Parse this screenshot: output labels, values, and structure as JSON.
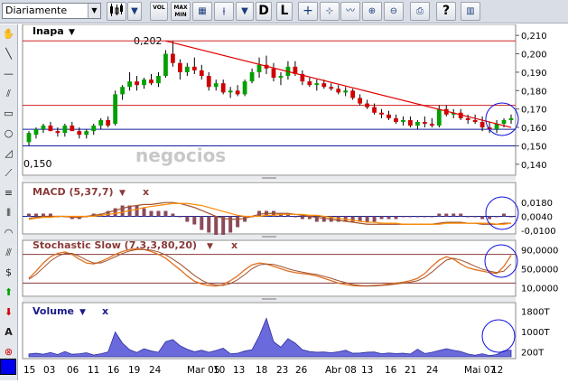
{
  "toolbar": {
    "period": "Diariamente",
    "vol_label": "VOL",
    "maxmin_label_1": "MAX",
    "maxmin_label_2": "MIN",
    "d_label": "D",
    "l_label": "L",
    "help_label": "?"
  },
  "price_panel": {
    "symbol": "Inapa",
    "high_annotation": "0,202",
    "low_annotation": "0,150",
    "watermark": "negocios",
    "y_ticks": [
      "0,210",
      "0,200",
      "0,190",
      "0,180",
      "0,170",
      "0,160",
      "0,150",
      "0,140"
    ]
  },
  "macd_panel": {
    "title": "MACD (5,37,7)",
    "close_label": "x",
    "y_ticks": [
      "0,0180",
      "0,0040",
      "-0,0100"
    ]
  },
  "stoch_panel": {
    "title": "Stochastic Slow (7,3,3,80,20)",
    "close_label": "x",
    "y_ticks": [
      "90,0000",
      "50,0000",
      "10,0000"
    ]
  },
  "volume_panel": {
    "title": "Volume",
    "close_label": "x",
    "y_ticks": [
      "1800T",
      "1000T",
      "200T"
    ]
  },
  "x_axis": [
    "15",
    "03",
    "06",
    "11",
    "16",
    "19",
    "24",
    "Mar 05",
    "10",
    "13",
    "18",
    "23",
    "26",
    "Abr 08",
    "13",
    "16",
    "21",
    "24",
    "Mai 07",
    "12"
  ],
  "colors": {
    "up_candle": "#00a000",
    "down_candle": "#d00000",
    "trendline": "#e00000",
    "support_line": "#1020a0",
    "highlight_circle": "#1010e0",
    "macd_line": "#a0522d",
    "signal_line": "#ff8c00",
    "histogram": "#8b4a5a",
    "volume_fill": "#6a6adc"
  },
  "chart_data": {
    "type": "candlestick",
    "title": "Inapa",
    "x_tick_labels": [
      "15",
      "03",
      "06",
      "11",
      "16",
      "19",
      "24",
      "Mar 05",
      "10",
      "13",
      "18",
      "23",
      "26",
      "Abr 08",
      "13",
      "16",
      "21",
      "24",
      "Mai 07",
      "12"
    ],
    "ylim": [
      0.135,
      0.215
    ],
    "candles": [
      [
        0.152,
        0.158,
        0.15,
        0.157
      ],
      [
        0.156,
        0.16,
        0.154,
        0.159
      ],
      [
        0.159,
        0.162,
        0.157,
        0.161
      ],
      [
        0.161,
        0.163,
        0.158,
        0.158
      ],
      [
        0.158,
        0.16,
        0.155,
        0.157
      ],
      [
        0.157,
        0.162,
        0.155,
        0.161
      ],
      [
        0.161,
        0.163,
        0.158,
        0.158
      ],
      [
        0.158,
        0.16,
        0.154,
        0.156
      ],
      [
        0.156,
        0.159,
        0.154,
        0.158
      ],
      [
        0.158,
        0.162,
        0.156,
        0.161
      ],
      [
        0.161,
        0.165,
        0.159,
        0.164
      ],
      [
        0.164,
        0.166,
        0.16,
        0.161
      ],
      [
        0.162,
        0.18,
        0.161,
        0.178
      ],
      [
        0.178,
        0.183,
        0.175,
        0.182
      ],
      [
        0.182,
        0.19,
        0.18,
        0.185
      ],
      [
        0.185,
        0.188,
        0.18,
        0.183
      ],
      [
        0.183,
        0.187,
        0.181,
        0.186
      ],
      [
        0.186,
        0.189,
        0.183,
        0.184
      ],
      [
        0.184,
        0.19,
        0.182,
        0.188
      ],
      [
        0.188,
        0.202,
        0.187,
        0.2
      ],
      [
        0.2,
        0.207,
        0.193,
        0.195
      ],
      [
        0.195,
        0.197,
        0.186,
        0.19
      ],
      [
        0.19,
        0.195,
        0.188,
        0.193
      ],
      [
        0.193,
        0.198,
        0.189,
        0.191
      ],
      [
        0.191,
        0.194,
        0.186,
        0.188
      ],
      [
        0.188,
        0.19,
        0.18,
        0.182
      ],
      [
        0.182,
        0.186,
        0.18,
        0.184
      ],
      [
        0.184,
        0.186,
        0.178,
        0.179
      ],
      [
        0.179,
        0.182,
        0.176,
        0.18
      ],
      [
        0.18,
        0.183,
        0.177,
        0.178
      ],
      [
        0.178,
        0.186,
        0.177,
        0.185
      ],
      [
        0.185,
        0.192,
        0.184,
        0.19
      ],
      [
        0.19,
        0.198,
        0.187,
        0.194
      ],
      [
        0.194,
        0.199,
        0.189,
        0.192
      ],
      [
        0.192,
        0.195,
        0.185,
        0.187
      ],
      [
        0.187,
        0.19,
        0.183,
        0.188
      ],
      [
        0.188,
        0.196,
        0.186,
        0.193
      ],
      [
        0.193,
        0.196,
        0.188,
        0.189
      ],
      [
        0.189,
        0.191,
        0.183,
        0.185
      ],
      [
        0.185,
        0.187,
        0.182,
        0.183
      ],
      [
        0.183,
        0.186,
        0.18,
        0.184
      ],
      [
        0.184,
        0.186,
        0.181,
        0.182
      ],
      [
        0.182,
        0.184,
        0.18,
        0.181
      ],
      [
        0.181,
        0.183,
        0.178,
        0.179
      ],
      [
        0.179,
        0.182,
        0.177,
        0.18
      ],
      [
        0.18,
        0.181,
        0.175,
        0.176
      ],
      [
        0.176,
        0.178,
        0.172,
        0.173
      ],
      [
        0.173,
        0.175,
        0.17,
        0.171
      ],
      [
        0.171,
        0.173,
        0.167,
        0.168
      ],
      [
        0.168,
        0.17,
        0.165,
        0.167
      ],
      [
        0.167,
        0.169,
        0.164,
        0.165
      ],
      [
        0.165,
        0.167,
        0.162,
        0.163
      ],
      [
        0.163,
        0.166,
        0.161,
        0.164
      ],
      [
        0.164,
        0.166,
        0.16,
        0.161
      ],
      [
        0.161,
        0.164,
        0.159,
        0.163
      ],
      [
        0.163,
        0.166,
        0.16,
        0.162
      ],
      [
        0.162,
        0.165,
        0.16,
        0.161
      ],
      [
        0.161,
        0.172,
        0.16,
        0.17
      ],
      [
        0.17,
        0.172,
        0.166,
        0.167
      ],
      [
        0.167,
        0.17,
        0.165,
        0.168
      ],
      [
        0.168,
        0.17,
        0.164,
        0.165
      ],
      [
        0.165,
        0.167,
        0.162,
        0.164
      ],
      [
        0.164,
        0.167,
        0.162,
        0.163
      ],
      [
        0.163,
        0.166,
        0.158,
        0.16
      ],
      [
        0.16,
        0.163,
        0.157,
        0.159
      ],
      [
        0.159,
        0.164,
        0.157,
        0.162
      ],
      [
        0.162,
        0.165,
        0.16,
        0.164
      ],
      [
        0.164,
        0.167,
        0.162,
        0.165
      ]
    ],
    "trendline": [
      [
        19,
        0.207
      ],
      [
        67,
        0.16
      ]
    ],
    "horizontal_lines": [
      0.207,
      0.172,
      0.159,
      0.15
    ],
    "macd": [
      0.002,
      0.003,
      0.004,
      0.004,
      0.004,
      0.004,
      0.003,
      0.003,
      0.004,
      0.005,
      0.006,
      0.008,
      0.01,
      0.012,
      0.014,
      0.015,
      0.016,
      0.016,
      0.017,
      0.018,
      0.018,
      0.017,
      0.015,
      0.013,
      0.01,
      0.007,
      0.004,
      0.002,
      0.001,
      0.001,
      0.002,
      0.004,
      0.006,
      0.007,
      0.007,
      0.007,
      0.007,
      0.006,
      0.005,
      0.004,
      0.003,
      0.002,
      0.001,
      0.0,
      -0.001,
      -0.002,
      -0.003,
      -0.004,
      -0.004,
      -0.004,
      -0.004,
      -0.004,
      -0.004,
      -0.004,
      -0.004,
      -0.004,
      -0.004,
      -0.003,
      -0.002,
      -0.002,
      -0.002,
      -0.003,
      -0.003,
      -0.004,
      -0.004,
      -0.004,
      -0.003,
      -0.003
    ],
    "macd_signal": [
      0.001,
      0.002,
      0.003,
      0.003,
      0.004,
      0.004,
      0.004,
      0.004,
      0.004,
      0.004,
      0.005,
      0.006,
      0.007,
      0.008,
      0.01,
      0.011,
      0.013,
      0.014,
      0.015,
      0.016,
      0.017,
      0.017,
      0.017,
      0.016,
      0.015,
      0.013,
      0.011,
      0.009,
      0.007,
      0.005,
      0.004,
      0.004,
      0.004,
      0.005,
      0.005,
      0.006,
      0.006,
      0.006,
      0.006,
      0.005,
      0.005,
      0.004,
      0.003,
      0.002,
      0.001,
      0.0,
      -0.001,
      -0.002,
      -0.002,
      -0.003,
      -0.003,
      -0.003,
      -0.004,
      -0.004,
      -0.004,
      -0.004,
      -0.004,
      -0.004,
      -0.003,
      -0.003,
      -0.003,
      -0.003,
      -0.003,
      -0.003,
      -0.003,
      -0.004,
      -0.004,
      -0.003
    ],
    "stoch_k": [
      30,
      45,
      62,
      75,
      82,
      85,
      80,
      70,
      62,
      60,
      65,
      72,
      80,
      86,
      90,
      92,
      90,
      86,
      80,
      72,
      60,
      48,
      35,
      24,
      18,
      15,
      14,
      17,
      25,
      35,
      48,
      58,
      62,
      60,
      55,
      50,
      45,
      42,
      40,
      38,
      35,
      30,
      25,
      20,
      17,
      15,
      14,
      14,
      15,
      16,
      18,
      20,
      22,
      25,
      30,
      40,
      55,
      68,
      75,
      70,
      60,
      52,
      48,
      45,
      42,
      40,
      55,
      78
    ],
    "stoch_d": [
      28,
      38,
      52,
      66,
      76,
      82,
      82,
      76,
      68,
      62,
      62,
      68,
      75,
      82,
      87,
      90,
      90,
      89,
      85,
      79,
      70,
      60,
      48,
      36,
      26,
      19,
      16,
      15,
      19,
      27,
      38,
      50,
      58,
      60,
      59,
      55,
      50,
      46,
      43,
      40,
      38,
      34,
      30,
      25,
      21,
      17,
      15,
      14,
      14,
      15,
      16,
      18,
      20,
      22,
      25,
      32,
      43,
      56,
      68,
      72,
      68,
      62,
      55,
      49,
      45,
      42,
      45,
      60
    ],
    "volume": [
      110,
      140,
      100,
      170,
      90,
      210,
      100,
      120,
      160,
      70,
      120,
      190,
      980,
      540,
      280,
      170,
      320,
      230,
      180,
      600,
      680,
      440,
      300,
      200,
      260,
      180,
      250,
      340,
      120,
      140,
      230,
      280,
      820,
      1520,
      600,
      380,
      720,
      540,
      280,
      210,
      180,
      190,
      160,
      200,
      260,
      140,
      150,
      180,
      190,
      120,
      150,
      130,
      140,
      110,
      300,
      130,
      180,
      250,
      320,
      260,
      210,
      110,
      60,
      120,
      50,
      90,
      240,
      260
    ]
  }
}
